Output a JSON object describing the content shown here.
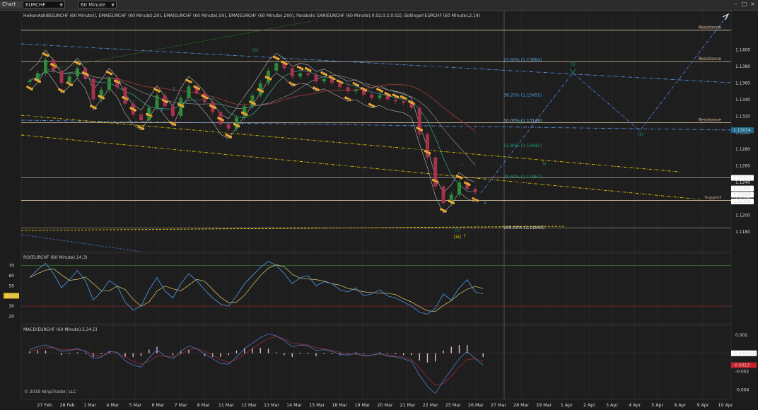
{
  "toolbar": {
    "tab_label": "Chart",
    "instrument": "EURCHF",
    "interval": "60 Minute"
  },
  "panels": {
    "price_header": "HeikenAshi8(EURCHF (60 Minute)), EMA(EURCHF (60 Minute),20), EMA(EURCHF (60 Minute),50), EMA(EURCHF (60 Minute),200), Parabolic SAR(EURCHF (60 Minute),0.02,0.2,0.02), Bollinger(EURCHF (60 Minute),2,14)",
    "rsi_header": "RSI(EURCHF (60 Minute),14,3)",
    "macd_header": "MACD(EURCHF (60 Minute),5,34,5)",
    "copyright": "© 2019 NinjaTrader, LLC"
  },
  "chart_data": [
    {
      "type": "line",
      "panel": "price",
      "x_axis_labels": [
        "27 Feb",
        "28 Feb",
        "1 Mar",
        "4 Mar",
        "5 Mar",
        "6 Mar",
        "7 Mar",
        "8 Mar",
        "11 Mar",
        "12 Mar",
        "13 Mar",
        "14 Mar",
        "15 Mar",
        "18 Mar",
        "19 Mar",
        "20 Mar",
        "21 Mar",
        "22 Mar",
        "25 Mar",
        "26 Mar",
        "27 Mar",
        "28 Mar",
        "29 Mar",
        "1 Apr",
        "2 Apr",
        "3 Apr",
        "4 Apr",
        "5 Apr",
        "8 Apr",
        "9 Apr",
        "10 Apr"
      ],
      "y_ticks": [
        "1.1400",
        "1.1380",
        "1.1360",
        "1.1340",
        "1.1320",
        "1.1300",
        "1.1280",
        "1.1260",
        "1.1240",
        "1.1220",
        "1.1200",
        "1.1180"
      ],
      "ylim": [
        1.1168,
        1.1428
      ],
      "series": [
        {
          "values": [
            1.1363,
            1.1372,
            1.1388,
            1.1375,
            1.136,
            1.1368,
            1.1378,
            1.1365,
            1.134,
            1.1352,
            1.1366,
            1.1355,
            1.1335,
            1.1322,
            1.1315,
            1.133,
            1.1345,
            1.1332,
            1.132,
            1.1342,
            1.1356,
            1.1348,
            1.1337,
            1.1325,
            1.131,
            1.1305,
            1.1318,
            1.1332,
            1.1345,
            1.136,
            1.1375,
            1.1384,
            1.1378,
            1.1368,
            1.1372,
            1.137,
            1.1362,
            1.1365,
            1.136,
            1.1355,
            1.135,
            1.1352,
            1.1346,
            1.1342,
            1.1345,
            1.134,
            1.1338,
            1.1336,
            1.133,
            1.1298,
            1.127,
            1.1235,
            1.1215,
            1.1225,
            1.124,
            1.1232,
            1.1228
          ]
        }
      ],
      "levels": [
        {
          "label": "Resistance",
          "value": 1.1424
        },
        {
          "label": "Resistance",
          "value": 1.1386
        },
        {
          "label": "Resistance",
          "value": 1.1312
        },
        {
          "label": "Support",
          "value": 1.1218
        }
      ],
      "price_tags": [
        {
          "text": "1.13034",
          "value": 1.1303,
          "color": "#1e6a8c"
        },
        {
          "text": "1.12453",
          "value": 1.12453,
          "color": "#ffffff"
        },
        {
          "text": "1.12325",
          "value": 1.12325,
          "color": "#ffffff"
        },
        {
          "text": "1.12249",
          "value": 1.12249,
          "color": "#ffffff"
        },
        {
          "text": "1.12168",
          "value": 1.12168,
          "color": "#ffffff"
        }
      ],
      "fibonacci": [
        {
          "text": "23.60% (1.13884)",
          "value": 1.13884,
          "color": "#4a9fd8"
        },
        {
          "text": "38.20% (1.13455)",
          "value": 1.13455,
          "color": "#4a9fd8"
        },
        {
          "text": "50.00% (1.13148)",
          "value": 1.13148,
          "color": "#7ab4d8"
        },
        {
          "text": "61.80% (1.12842)",
          "value": 1.12842,
          "color": "#1aa07a"
        },
        {
          "text": "78.60% (1.12467)",
          "value": 1.12467,
          "color": "#1aa07a"
        },
        {
          "text": "100.00% (1.11849)",
          "value": 1.11849,
          "color": "#cfcfcf"
        }
      ],
      "wave_labels": [
        {
          "text": "(b)",
          "color": "#1aa07a"
        },
        {
          "text": "(c)",
          "color": "#1aa07a"
        },
        {
          "text": "[iii]",
          "color": "#e8d000"
        },
        {
          "text": "?",
          "color": "#e8d000"
        },
        {
          "text": "i",
          "color": "#4a9fd8"
        },
        {
          "text": "ii",
          "color": "#4a9fd8"
        },
        {
          "text": "iii",
          "color": "#1aa07a"
        },
        {
          "text": "iv",
          "color": "#1aa07a"
        },
        {
          "text": "(i)",
          "color": "#1aa07a"
        },
        {
          "text": "(ii)",
          "color": "#1aa07a"
        },
        {
          "text": "2",
          "color": "#4a9fd8"
        },
        {
          "text": "1",
          "color": "#4a9fd8"
        }
      ]
    },
    {
      "type": "line",
      "panel": "rsi",
      "y_ticks": [
        "70",
        "60",
        "50",
        "40",
        "30",
        "20"
      ],
      "ylim": [
        14,
        78
      ],
      "current_value": "40.15",
      "series": [
        {
          "name": "RSI",
          "values": [
            58,
            66,
            72,
            62,
            48,
            56,
            65,
            55,
            36,
            44,
            55,
            50,
            34,
            26,
            30,
            46,
            58,
            45,
            38,
            52,
            62,
            55,
            46,
            38,
            32,
            30,
            40,
            52,
            60,
            68,
            74,
            70,
            62,
            52,
            58,
            60,
            50,
            54,
            52,
            46,
            44,
            48,
            40,
            42,
            46,
            40,
            38,
            34,
            30,
            24,
            22,
            28,
            42,
            36,
            48,
            56,
            44,
            42
          ]
        }
      ]
    },
    {
      "type": "bar",
      "panel": "macd",
      "y_ticks": [
        "0.002",
        "0",
        "-0.002",
        "-0.004"
      ],
      "ylim": [
        -0.0048,
        0.0026
      ],
      "current_values": [
        "-0.0000026",
        "-0.0013"
      ],
      "series": [
        {
          "name": "MACD",
          "values": [
            0.0004,
            0.0007,
            0.0009,
            0.0006,
            0.0002,
            0.0003,
            0.0005,
            0.0002,
            -0.0006,
            -0.0004,
            0.0002,
            0.0001,
            -0.0008,
            -0.0013,
            -0.0015,
            -0.0005,
            0.0004,
            -0.0003,
            -0.0006,
            0.0002,
            0.0008,
            0.0005,
            -0.0001,
            -0.0006,
            -0.0011,
            -0.0012,
            -0.0004,
            0.0005,
            0.0011,
            0.0017,
            0.0021,
            0.0019,
            0.0014,
            0.0007,
            0.0009,
            0.0008,
            0.0003,
            0.0004,
            0.0002,
            -0.0001,
            -0.0002,
            0.0,
            -0.0003,
            -0.0002,
            0.0,
            -0.0003,
            -0.0004,
            -0.0006,
            -0.0009,
            -0.0024,
            -0.0036,
            -0.0044,
            -0.003,
            -0.0018,
            -0.0006,
            0.0002,
            -0.0006,
            -0.0013
          ]
        },
        {
          "name": "Signal",
          "values": [
            0.0002,
            0.0004,
            0.0006,
            0.0006,
            0.0004,
            0.0004,
            0.0004,
            0.0003,
            -0.0002,
            -0.0003,
            0.0,
            0.0,
            -0.0004,
            -0.0009,
            -0.0012,
            -0.0009,
            -0.0003,
            -0.0003,
            -0.0004,
            -0.0001,
            0.0004,
            0.0005,
            0.0002,
            -0.0002,
            -0.0007,
            -0.001,
            -0.0007,
            -0.0001,
            0.0005,
            0.0011,
            0.0016,
            0.0018,
            0.0016,
            0.0011,
            0.001,
            0.0009,
            0.0006,
            0.0005,
            0.0003,
            0.0001,
            -0.0001,
            -0.0001,
            -0.0002,
            -0.0002,
            -0.0001,
            -0.0002,
            -0.0003,
            -0.0004,
            -0.0007,
            -0.0016,
            -0.0026,
            -0.0035,
            -0.0033,
            -0.0025,
            -0.0015,
            -0.0007,
            -0.0006,
            -0.0009
          ]
        }
      ]
    }
  ]
}
